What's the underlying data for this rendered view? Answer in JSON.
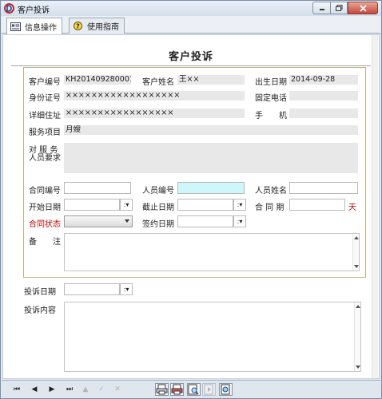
{
  "window": {
    "title": "客户投诉"
  },
  "tabs": [
    {
      "label": "信息操作",
      "icon": "info-panel-icon"
    },
    {
      "label": "使用指南",
      "icon": "help-icon"
    }
  ],
  "form": {
    "title": "客户投诉",
    "customer_no": {
      "label": "客户编号",
      "value": "KH201409280001"
    },
    "customer_name": {
      "label": "客户姓名",
      "value": "王××"
    },
    "birth_date": {
      "label": "出生日期",
      "value": "2014-09-28"
    },
    "id_no": {
      "label": "身份证号",
      "value": "××××××××××××××××××"
    },
    "landline": {
      "label": "固定电话",
      "value": ""
    },
    "address": {
      "label": "详细住址",
      "value": "×××××××××××××××××"
    },
    "mobile": {
      "label": "手　　机",
      "value": ""
    },
    "service": {
      "label": "服务项目",
      "value": "月嫂"
    },
    "staff_req": {
      "label_line1": "对 服 务",
      "label_line2": "人员要求",
      "value": ""
    },
    "contract_no": {
      "label": "合同编号"
    },
    "staff_no": {
      "label": "人员编号"
    },
    "staff_name": {
      "label": "人员姓名"
    },
    "start_date": {
      "label": "开始日期"
    },
    "end_date": {
      "label": "截止日期"
    },
    "contract_period": {
      "label": "合 同 期",
      "unit": "天"
    },
    "contract_status": {
      "label": "合同状态"
    },
    "sign_date": {
      "label": "签约日期"
    },
    "remarks": {
      "label": "备　　注"
    },
    "complaint_date": {
      "label": "投诉日期"
    },
    "complaint_content": {
      "label": "投诉内容"
    },
    "spinner_glyph": ":▾"
  },
  "nav": {
    "first": "⏮",
    "prev": "◀",
    "next": "▶",
    "last": "⏭",
    "up": "▲",
    "check": "✓",
    "cancel": "✕"
  },
  "colors": {
    "accent_red": "#c00000",
    "panel_border": "#bdb27a",
    "highlight_cyan": "#cdf7fb"
  }
}
